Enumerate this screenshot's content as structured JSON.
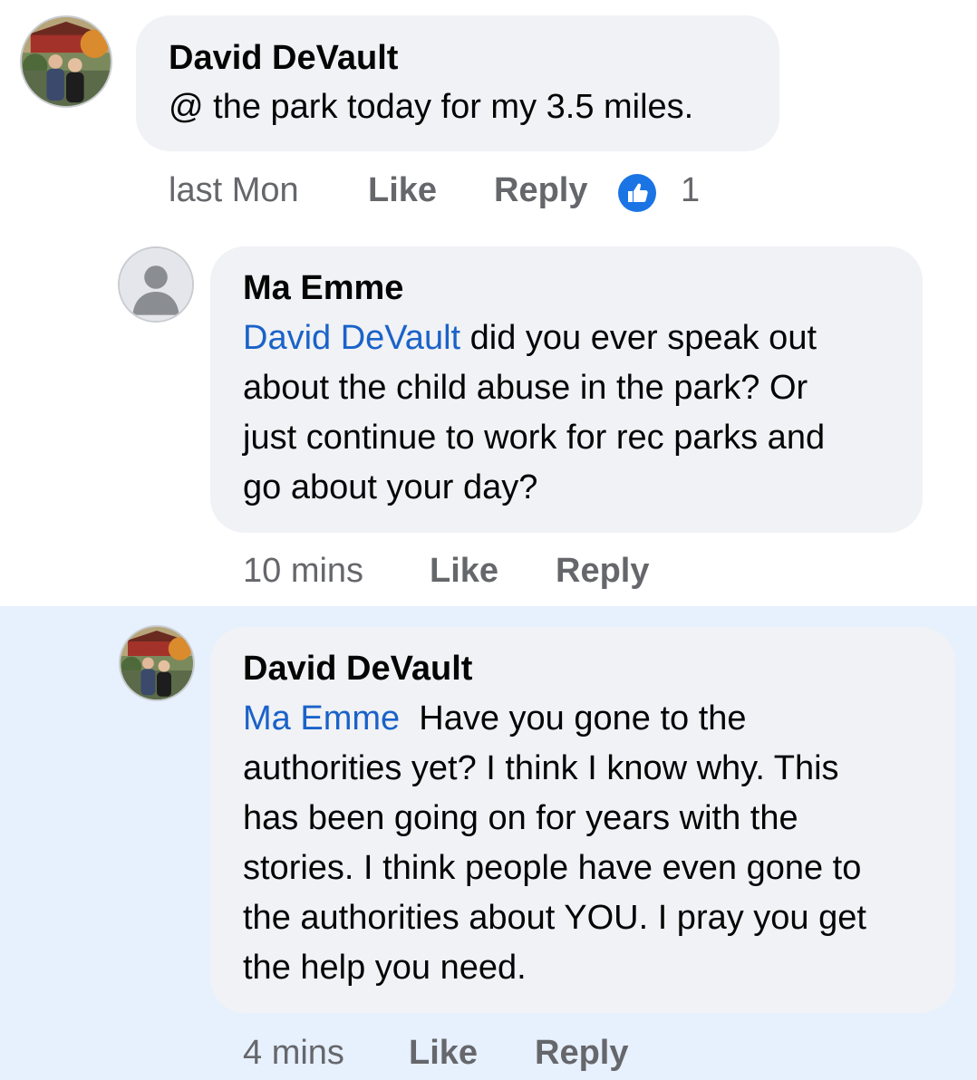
{
  "comments": [
    {
      "author": "David DeVault",
      "mention": "",
      "text": "@ the park today for my 3.5 miles.",
      "time": "last Mon",
      "like_label": "Like",
      "reply_label": "Reply",
      "reaction_icon": "thumbs-up-icon",
      "reaction_count": "1",
      "avatar_icon": "photo-avatar"
    },
    {
      "author": "Ma Emme",
      "mention": "David DeVault",
      "text_lines": [
        " did you ever speak out",
        "about the child abuse in the park? Or",
        "just continue to work for rec parks and",
        "go about your day?"
      ],
      "time": "10 mins",
      "like_label": "Like",
      "reply_label": "Reply",
      "avatar_icon": "default-person-icon"
    },
    {
      "author": "David DeVault",
      "mention": "Ma Emme",
      "text_lines": [
        "  Have you gone to the",
        "authorities yet? I think I know why. This",
        "has been going on for years with the",
        "stories. I think people have even gone to",
        "the authorities about YOU. I pray you get",
        "the help you need."
      ],
      "time": "4 mins",
      "like_label": "Like",
      "reply_label": "Reply",
      "avatar_icon": "photo-avatar",
      "highlighted": true
    }
  ],
  "colors": {
    "bubble": "#f0f2f5",
    "mention": "#1a62c9",
    "meta": "#65676b",
    "highlight": "#e7f0fd",
    "like_reaction": "#1b74e4"
  }
}
